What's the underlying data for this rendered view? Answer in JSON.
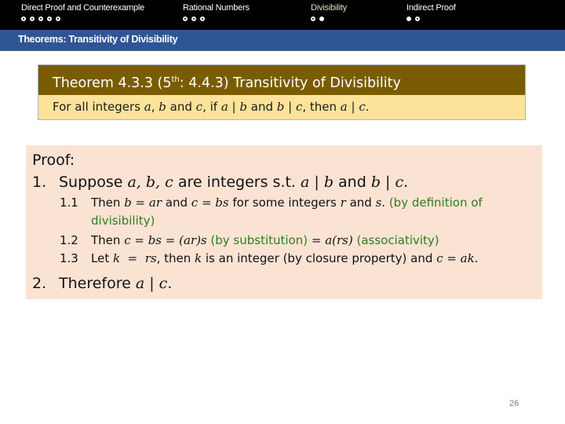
{
  "nav": {
    "sections": [
      {
        "title": "Direct Proof and Counterexample",
        "active": false,
        "dots": [
          false,
          false,
          false,
          false,
          false
        ]
      },
      {
        "title": "Rational Numbers",
        "active": false,
        "dots": [
          false,
          false,
          false
        ]
      },
      {
        "title": "Divisibility",
        "active": true,
        "dots": [
          false,
          true
        ]
      },
      {
        "title": "Indirect Proof",
        "active": false,
        "dots": [
          true,
          false
        ]
      }
    ]
  },
  "subtitle": "Theorems: Transitivity of Divisibility",
  "theorem": {
    "head_pre": "Theorem 4.3.3 (5",
    "head_sup": "th",
    "head_post": ": 4.4.3) Transitivity of Divisibility",
    "statement": {
      "t1": "For all integers ",
      "a": "a",
      "t2": ", ",
      "b": "b",
      "t3": " and ",
      "c": "c",
      "t4": ", if ",
      "m1": "a | b",
      "t5": " and ",
      "m2": "b | c",
      "t6": ", then ",
      "m3": "a | c",
      "t7": "."
    }
  },
  "proof": {
    "label": "Proof:",
    "step1": {
      "num": "1.",
      "t1": "Suppose ",
      "m1": "a, b, c",
      "t2": " are integers s.t. ",
      "m2": "a | b",
      "t3": " and ",
      "m3": "b | c",
      "t4": "."
    },
    "step11": {
      "num": "1.1",
      "t1": "Then ",
      "m1": "b = ar",
      "t2": " and ",
      "m2": "c = bs",
      "t3": " for some integers ",
      "m3": "r",
      "t4": " and ",
      "m4": "s",
      "t5": ". ",
      "g1": "(by definition of",
      "g2": "divisibility)"
    },
    "step12": {
      "num": "1.2",
      "t1": "Then ",
      "m1": "c = bs = (ar)s",
      "g1": " (by substitution) ",
      "m2": "= a(rs)",
      "g2": " (associativity)"
    },
    "step13": {
      "num": "1.3",
      "t1": "Let ",
      "m1": "k  =  rs",
      "t2": ", then ",
      "m2": "k",
      "t3": " is an integer (by closure property) and ",
      "m3": "c = ak",
      "t4": "."
    },
    "step2": {
      "num": "2.",
      "t1": "Therefore ",
      "m1": "a | c",
      "t2": "."
    }
  },
  "page_number": "26"
}
